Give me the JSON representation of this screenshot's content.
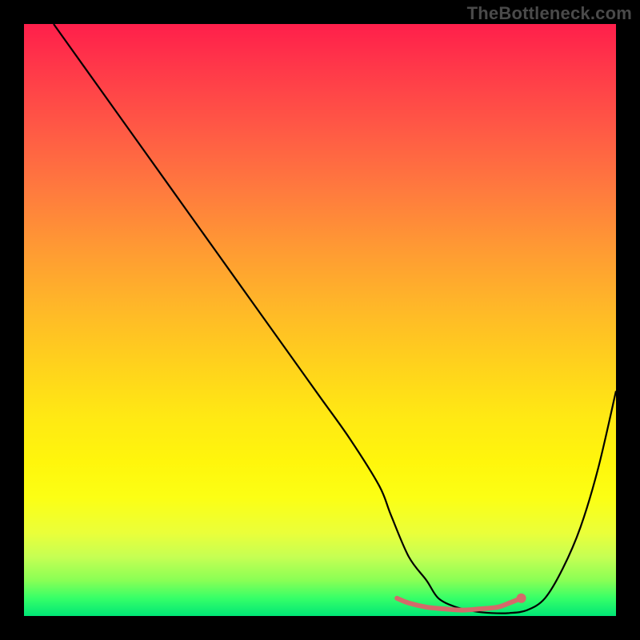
{
  "watermark": "TheBottleneck.com",
  "colors": {
    "frame": "#000000",
    "curve": "#000000",
    "baseline": "#d46a6a",
    "dot": "#d46a6a"
  },
  "chart_data": {
    "type": "line",
    "title": "",
    "xlabel": "",
    "ylabel": "",
    "xlim": [
      0,
      100
    ],
    "ylim": [
      0,
      100
    ],
    "grid": false,
    "legend": false,
    "series": [
      {
        "name": "bottleneck-curve",
        "x": [
          5,
          10,
          15,
          20,
          25,
          30,
          35,
          40,
          45,
          50,
          55,
          60,
          62,
          65,
          68,
          70,
          73,
          76,
          79,
          82,
          85,
          88,
          91,
          94,
          97,
          100
        ],
        "y": [
          100,
          93,
          86,
          79,
          72,
          65,
          58,
          51,
          44,
          37,
          30,
          22,
          17,
          10,
          6,
          3,
          1.5,
          0.8,
          0.5,
          0.5,
          1,
          3,
          8,
          15,
          25,
          38
        ]
      },
      {
        "name": "optimum-band",
        "x": [
          63,
          65,
          68,
          71,
          74,
          77,
          80,
          82,
          84
        ],
        "y": [
          3.0,
          2.2,
          1.5,
          1.2,
          1.0,
          1.2,
          1.5,
          2.2,
          3.0
        ]
      }
    ],
    "annotations": [
      {
        "name": "optimum-end-dot",
        "x": 84,
        "y": 3.0
      }
    ]
  }
}
